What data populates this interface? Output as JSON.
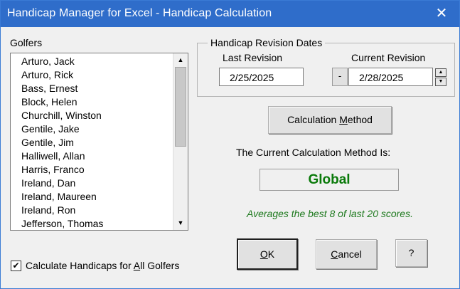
{
  "window": {
    "title": "Handicap Manager for Excel - Handicap Calculation",
    "close_glyph": "✕"
  },
  "golfers": {
    "label": "Golfers",
    "items": [
      "Arturo, Jack",
      "Arturo, Rick",
      "Bass, Ernest",
      "Block, Helen",
      "Churchill, Winston",
      "Gentile, Jake",
      "Gentile, Jim",
      "Halliwell, Allan",
      "Harris, Franco",
      "Ireland, Dan",
      "Ireland, Maureen",
      "Ireland, Ron",
      "Jefferson, Thomas"
    ]
  },
  "revision": {
    "group_title": "Handicap Revision Dates",
    "last_label": "Last Revision",
    "last_value": "2/25/2025",
    "current_label": "Current Revision",
    "current_value": "2/28/2025",
    "minus_label": "-"
  },
  "calc": {
    "button_prefix": "Calculation ",
    "button_hotkey": "M",
    "button_suffix": "ethod",
    "current_label": "The Current Calculation Method Is:",
    "method_value": "Global",
    "note": "Averages the best 8 of last 20 scores."
  },
  "checkbox": {
    "checked": true,
    "glyph": "✔",
    "label_prefix": "Calculate Handicaps for ",
    "label_hotkey": "A",
    "label_suffix": "ll Golfers"
  },
  "buttons": {
    "ok_hotkey": "O",
    "ok_rest": "K",
    "cancel_hotkey": "C",
    "cancel_rest": "ancel",
    "help_label": "?"
  },
  "colors": {
    "titlebar": "#2f6dca",
    "method_text": "#0a7a0a",
    "note_text": "#1f7a1f"
  }
}
